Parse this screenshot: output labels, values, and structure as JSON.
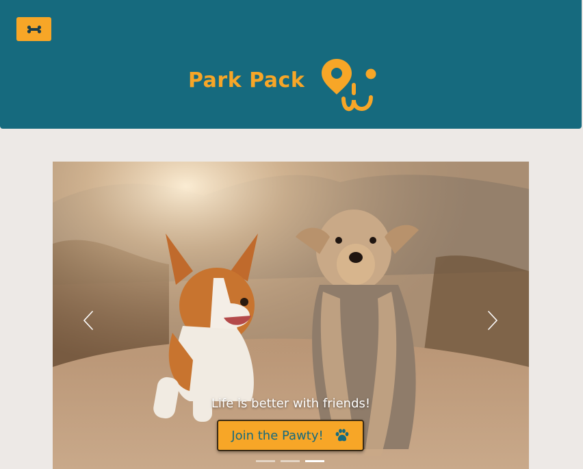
{
  "header": {
    "brand_name": "Park Pack",
    "menu_icon": "bone-icon",
    "logo_icon": "map-pin-dog-face-logo",
    "colors": {
      "background": "#166a7e",
      "accent": "#f7a627"
    }
  },
  "carousel": {
    "prev_icon": "chevron-left-icon",
    "next_icon": "chevron-right-icon",
    "caption": "Life is better with friends!",
    "cta_label": "Join the Pawty!",
    "cta_icon": "paw-icon",
    "slide_count": 3,
    "active_slide": 3
  }
}
